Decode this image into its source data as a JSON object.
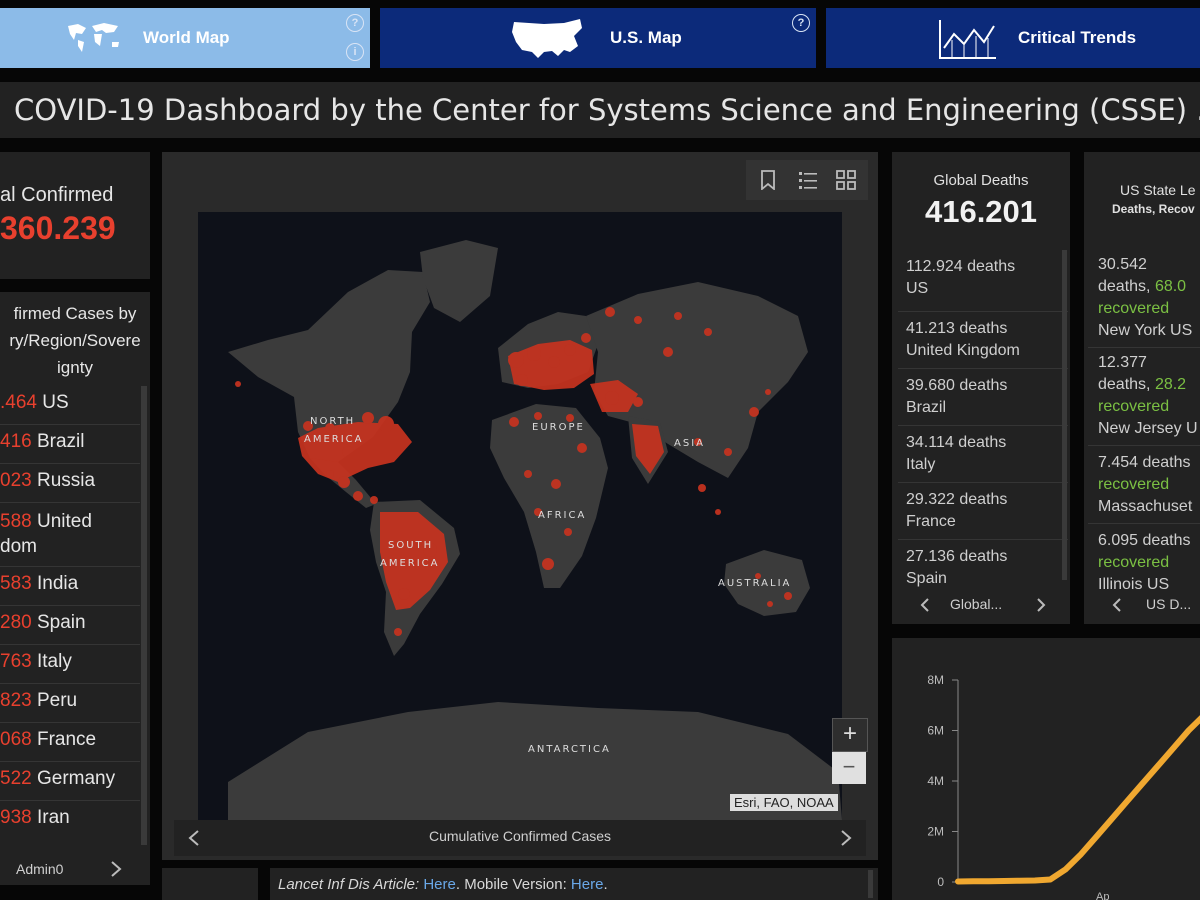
{
  "nav": {
    "tabs": [
      {
        "label": "World Map"
      },
      {
        "label": "U.S. Map"
      },
      {
        "label": "Critical Trends"
      }
    ],
    "help_glyph": "?",
    "info_glyph": "i"
  },
  "header": {
    "title": "COVID-19 Dashboard by the Center for Systems Science and Engineering (CSSE) ..."
  },
  "total_confirmed": {
    "label": "al Confirmed",
    "value": "360.239"
  },
  "confirmed_list": {
    "header_lines": [
      "firmed Cases by",
      "ry/Region/Sovere",
      "ignty"
    ],
    "rows": [
      {
        "num": ".464",
        "name": "US"
      },
      {
        "num": "416",
        "name": "Brazil"
      },
      {
        "num": "023",
        "name": "Russia"
      },
      {
        "num": "588",
        "name": "United",
        "name2": "dom"
      },
      {
        "num": "583",
        "name": "India"
      },
      {
        "num": "280",
        "name": "Spain"
      },
      {
        "num": "763",
        "name": "Italy"
      },
      {
        "num": "823",
        "name": "Peru"
      },
      {
        "num": "068",
        "name": "France"
      },
      {
        "num": "522",
        "name": "Germany"
      },
      {
        "num": "938",
        "name": "Iran"
      }
    ],
    "footer": "Admin0"
  },
  "map": {
    "labels": {
      "north_america_1": "NORTH",
      "north_america_2": "AMERICA",
      "europe": "EUROPE",
      "asia": "ASIA",
      "africa": "AFRICA",
      "south_america_1": "SOUTH",
      "south_america_2": "AMERICA",
      "australia": "AUSTRALIA",
      "antarctica": "ANTARCTICA"
    },
    "attribution": "Esri, FAO, NOAA",
    "footer": "Cumulative Confirmed Cases",
    "zoom_in": "+",
    "zoom_out": "−",
    "colors": {
      "ocean": "#0e1119",
      "land": "#3b3b3b",
      "bubble": "#c8331f"
    }
  },
  "global_deaths": {
    "label": "Global Deaths",
    "value": "416.201",
    "rows": [
      {
        "line1": "112.924 deaths",
        "line2": "US"
      },
      {
        "line1": "41.213 deaths",
        "line2": "United Kingdom"
      },
      {
        "line1": "39.680 deaths",
        "line2": "Brazil"
      },
      {
        "line1": "34.114 deaths",
        "line2": "Italy"
      },
      {
        "line1": "29.322 deaths",
        "line2": "France"
      },
      {
        "line1": "27.136 deaths",
        "line2": "Spain"
      }
    ],
    "footer": "Global..."
  },
  "us_state": {
    "label1": "US State Le",
    "label2": "Deaths, Recov",
    "rows": [
      {
        "line1": "30.542",
        "line2a": "deaths, ",
        "line2b": "68.0",
        "line3": "recovered",
        "line4": "New York US"
      },
      {
        "line1": "12.377",
        "line2a": "deaths, ",
        "line2b": "28.2",
        "line3": "recovered",
        "line4": "New Jersey U"
      },
      {
        "line1": "7.454 deaths",
        "line3": "recovered",
        "line4": "Massachuset"
      },
      {
        "line1": "6.095 deaths",
        "line3": "recovered",
        "line4": "Illinois US"
      }
    ],
    "footer": "US D..."
  },
  "trend_chart": {
    "y_ticks": [
      "8M",
      "6M",
      "4M",
      "2M",
      "0"
    ],
    "x_tick": "Ap",
    "line_color": "#f0a830"
  },
  "bottom_bar": {
    "prefix": "Lancet Inf Dis Article: ",
    "link1": "Here",
    "mid": ". Mobile Version: ",
    "link2": "Here",
    "suffix": "."
  },
  "chart_data": {
    "type": "line",
    "ylim": [
      0,
      8000000
    ],
    "y_ticks": [
      "8M",
      "6M",
      "4M",
      "2M",
      "0"
    ],
    "x_ticks": [
      "Ap"
    ],
    "series": [
      {
        "values": [
          0.02,
          0.03,
          0.03,
          0.04,
          0.05,
          0.06,
          0.1,
          0.5,
          1.1,
          1.8,
          2.5,
          3.2,
          3.9,
          4.6,
          5.3,
          6.0,
          6.6
        ]
      }
    ],
    "value_unit_note": "values in millions"
  }
}
